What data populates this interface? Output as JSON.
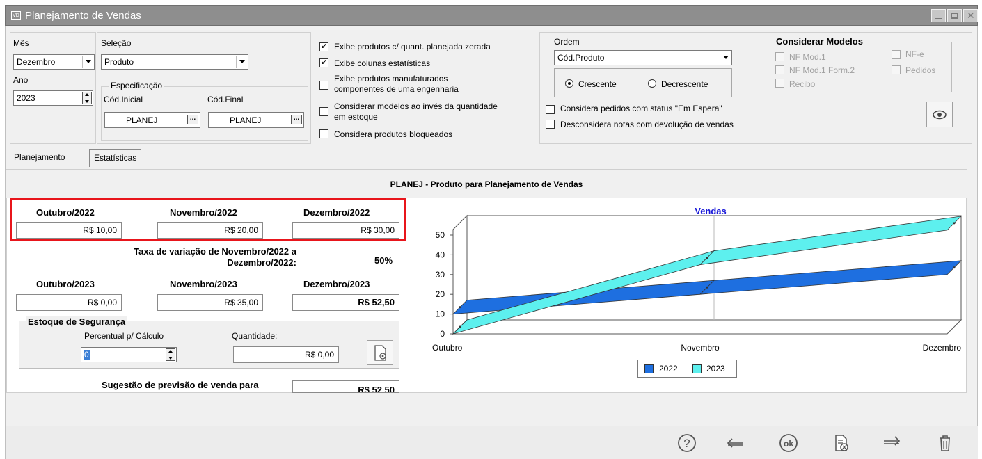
{
  "window": {
    "title": "Planejamento de Vendas",
    "icon_text": "VD"
  },
  "filters": {
    "mes_label": "Mês",
    "mes_value": "Dezembro",
    "ano_label": "Ano",
    "ano_value": "2023",
    "selecao_label": "Seleção",
    "selecao_value": "Produto",
    "especificacao_label": "Especificação",
    "cod_inicial_label": "Cód.Inicial",
    "cod_inicial_value": "PLANEJ",
    "cod_final_label": "Cód.Final",
    "cod_final_value": "PLANEJ"
  },
  "checkboxes": [
    {
      "label": "Exibe produtos c/ quant. planejada zerada",
      "checked": true
    },
    {
      "label": "Exibe colunas estatísticas",
      "checked": true
    },
    {
      "label": "Exibe produtos manufaturados\ncomponentes de uma engenharia",
      "checked": false
    },
    {
      "label": "Considerar modelos ao invés da quantidade\nem estoque",
      "checked": false
    },
    {
      "label": "Considera produtos bloqueados",
      "checked": false
    }
  ],
  "ordem": {
    "label": "Ordem",
    "value": "Cód.Produto",
    "crescente": "Crescente",
    "decrescente": "Decrescente",
    "selected": "Crescente"
  },
  "status_checks": [
    {
      "label": "Considera pedidos com status \"Em Espera\"",
      "checked": false
    },
    {
      "label": "Desconsidera notas com devolução de vendas",
      "checked": false
    }
  ],
  "modelos": {
    "title": "Considerar Modelos",
    "nf_mod1": "NF Mod.1",
    "nf_mod1_form2": "NF Mod.1 Form.2",
    "recibo": "Recibo",
    "nfe": "NF-e",
    "pedidos": "Pedidos"
  },
  "tabs": [
    "Planejamento",
    "Estatísticas"
  ],
  "product_header": "PLANEJ - Produto para Planejamento de Vendas",
  "prev_year": {
    "labels": [
      "Outubro/2022",
      "Novembro/2022",
      "Dezembro/2022"
    ],
    "values": [
      "R$ 10,00",
      "R$ 20,00",
      "R$ 30,00"
    ]
  },
  "taxa_label": "Taxa de variação de Novembro/2022 a\nDezembro/2022:",
  "taxa_value": "50%",
  "cur_year": {
    "labels": [
      "Outubro/2023",
      "Novembro/2023",
      "Dezembro/2023"
    ],
    "values": [
      "R$ 0,00",
      "R$ 35,00",
      "R$ 52,50"
    ]
  },
  "estoque": {
    "title": "Estoque de Segurança",
    "perc_label": "Percentual p/ Cálculo",
    "perc_value": "0",
    "qtd_label": "Quantidade:",
    "qtd_value": "R$ 0,00"
  },
  "sugestao_label": "Sugestão de previsão de venda para",
  "sugestao_value": "R$ 52,50",
  "chart_data": {
    "type": "line",
    "title": "Vendas",
    "categories": [
      "Outubro",
      "Novembro",
      "Dezembro"
    ],
    "series": [
      {
        "name": "2022",
        "values": [
          10,
          20,
          30
        ],
        "color": "#1e6fe0"
      },
      {
        "name": "2023",
        "values": [
          0,
          35,
          52.5
        ],
        "color": "#5df0ee"
      }
    ],
    "ylim": [
      0,
      50
    ],
    "yticks": [
      0,
      10,
      20,
      30,
      40,
      50
    ],
    "legend": "bottom",
    "grid": true
  },
  "colors": {
    "accent_red": "#e8151b",
    "chart_title": "#1a1ad8"
  }
}
